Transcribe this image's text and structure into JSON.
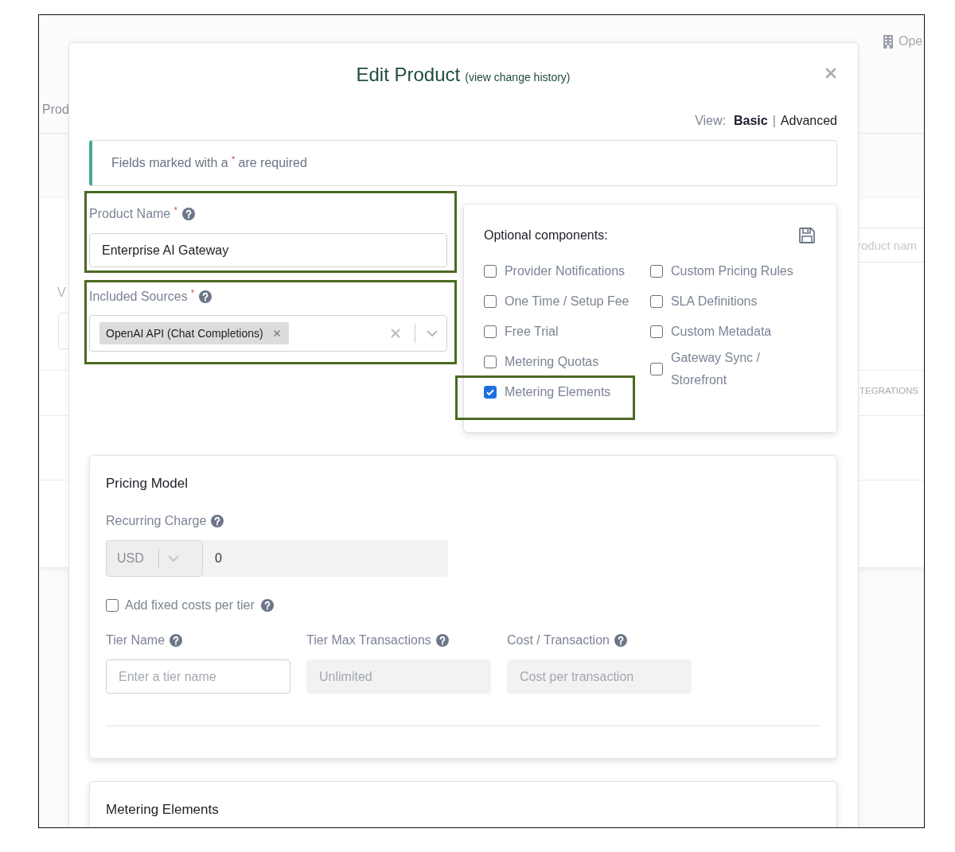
{
  "background": {
    "header_link": "Ope",
    "tab": "Prod",
    "filter_letter": "V",
    "search": {
      "placeholder": "roduct nam"
    },
    "column_heading": "TEGRATIONS"
  },
  "modal": {
    "title": "Edit Product",
    "history_link": "(view change history)",
    "view_switch": {
      "label": "View:",
      "options": [
        {
          "label": "Basic",
          "selected": true
        },
        {
          "label": "Advanced",
          "selected": false
        }
      ],
      "separator": "|"
    },
    "notice": "Fields marked with a $^{*}$ are required",
    "fields": [
      {
        "kind": "text",
        "label": "Product Name $^{*}$",
        "help": true,
        "value": "Enterprise AI Gateway",
        "highlighted": true
      },
      {
        "kind": "multiselect",
        "label": "Included Sources $^{*}$",
        "help": true,
        "chips": [
          "OpenAI API (Chat Completions)"
        ],
        "highlighted": true
      }
    ],
    "optional_components": {
      "title": "Optional components:",
      "columns": [
        {
          "items": [
            {
              "label": "Provider Notifications",
              "checked": false,
              "highlighted": false
            },
            {
              "label": "One Time / Setup Fee",
              "checked": false,
              "highlighted": false
            },
            {
              "label": "Free Trial",
              "checked": false,
              "highlighted": false
            },
            {
              "label": "Metering Quotas",
              "checked": false,
              "highlighted": false
            },
            {
              "label": "Metering Elements",
              "checked": true,
              "highlighted": true
            }
          ]
        },
        {
          "items": [
            {
              "label": "Custom Pricing Rules",
              "checked": false,
              "highlighted": false
            },
            {
              "label": "SLA Definitions",
              "checked": false,
              "highlighted": false
            },
            {
              "label": "Custom Metadata",
              "checked": false,
              "highlighted": false
            },
            {
              "label": "Gateway Sync / Storefront",
              "checked": false,
              "highlighted": false
            }
          ]
        }
      ]
    },
    "pricing": {
      "title": "Pricing Model",
      "recurring_label": "Recurring Charge",
      "currency": "USD",
      "amount": "0",
      "fixed_costs": {
        "label": "Add fixed costs per tier",
        "checked": false
      },
      "tier_fields": [
        {
          "label": "Tier Name",
          "placeholder": "Enter a tier name",
          "disabled": false
        },
        {
          "label": "Tier Max Transactions",
          "placeholder": "Unlimited",
          "disabled": true
        },
        {
          "label": "Cost / Transaction",
          "placeholder": "Cost per transaction",
          "disabled": true
        }
      ]
    },
    "metering": {
      "title": "Metering Elements"
    }
  }
}
